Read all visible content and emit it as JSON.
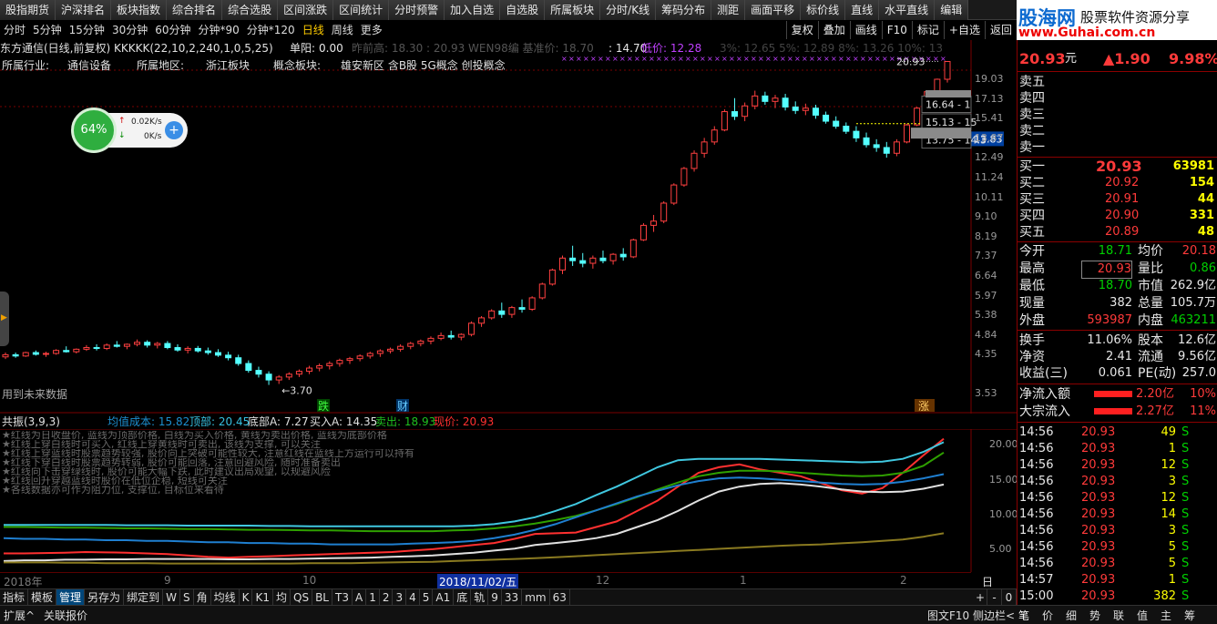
{
  "toolbar": {
    "buttons": [
      "股指期货",
      "沪深排名",
      "板块指数",
      "综合排名",
      "综合选股",
      "区间涨跌",
      "区间统计",
      "分时预警",
      "加入自选",
      "自选股",
      "所属板块",
      "分时/K线",
      "筹码分布",
      "测距",
      "画面平移",
      "标价线",
      "直线",
      "水平直线",
      "编辑"
    ]
  },
  "logo": {
    "main": "股海网",
    "tag": "股票软件资源分享",
    "url": "www.Guhai.com.cn"
  },
  "period_bar": {
    "periods": [
      "分时",
      "5分钟",
      "15分钟",
      "30分钟",
      "60分钟",
      "分钟*90",
      "分钟*120",
      "日线",
      "周线",
      "更多"
    ],
    "active": "日线",
    "right_buttons": [
      "复权",
      "叠加",
      "画线",
      "F10",
      "标记",
      "+自选",
      "返回"
    ]
  },
  "info": {
    "stock": "东方通信(日线,前复权) KKKKK(22,10,2,240,1,0,5,25)",
    "dange_label": "单阳:",
    "dange_value": "0.00",
    "faded": "昨前高: 18.30   : 20.93  WEN98编  基准价: 18.70",
    "mid_value": ": 14.70",
    "low_label": "低价: 12.28",
    "pct": "3%: 12.65  5%: 12.89  8%: 13.26  10%: 13",
    "industry_label": "所属行业:",
    "industry": "通信设备",
    "region_label": "所属地区:",
    "region": "浙江板块",
    "concept_label": "概念板块:",
    "concept": "雄安新区 含B股 5G概念 创投概念"
  },
  "widget": {
    "percent": "64%",
    "up_speed": "0.02K/s",
    "down_speed": "0K/s"
  },
  "price_axis": [
    "19.03",
    "17.13",
    "15.41",
    "13.87",
    "12.49",
    "11.24",
    "10.11",
    "9.10",
    "8.19",
    "7.37",
    "6.64",
    "5.97",
    "5.38",
    "4.84",
    "4.35",
    "3.53"
  ],
  "price_axis_ticks": [
    19.03,
    17.13,
    15.41,
    13.87,
    12.49,
    11.24,
    10.11,
    9.1,
    8.19,
    7.37,
    6.64,
    5.97,
    5.38,
    4.84,
    4.35,
    3.53
  ],
  "axis_top_label": "20.93",
  "current_price_tag": "13.83",
  "range_boxes": [
    "16.64 - 1",
    "15.13 - 15",
    "13.75 - 14.3"
  ],
  "low_marker": "3.70",
  "chart_notes": {
    "future": "用到未来数据",
    "die": "跌",
    "cai": "财",
    "zhang": "涨"
  },
  "indicator": {
    "name": "共振(3,9,3)",
    "avg_cost": "均值成本: 15.82",
    "top": "顶部: 20.45",
    "bottom": "底部A: 7.27",
    "buy": "买入A: 14.35",
    "sell": "卖出: 18.93",
    "current": "现价: 20.93",
    "axis": [
      "20.00",
      "15.00",
      "10.00",
      "5.00"
    ],
    "axis_ticks": [
      20,
      15,
      10,
      5
    ],
    "notes": [
      "红线为日收盘价, 蓝线为顶部价格, 白线为买入价格, 黄线为卖出价格, 蓝线为底部价格",
      "红线上穿白线时可买入, 红线上穿黄线时可卖出, 该线为支撑, 可以关注",
      "红线上穿蓝线时股票趋势较强, 股价向上突破可能性较大, 注意红线在蓝线上方运行可以持有",
      "红线下穿白线时股票趋势转弱, 股价可能回落, 注意回避风险, 随时准备卖出",
      "红线向下击穿绿线时, 股价可能大幅下跌, 此时建议出局观望, 以规避风险",
      "红线回升穿越蓝线时股价在低位企稳, 短线可关注",
      "各线数据亦可作为阻力位, 支撑位, 目标位来看待"
    ]
  },
  "date_axis": {
    "labels": [
      "2018年",
      "9",
      "10",
      "2018/11/02/五",
      "12",
      "1",
      "2"
    ],
    "right": "日线"
  },
  "bottom_bar": [
    "指标",
    "模板",
    "管理",
    "另存为",
    "绑定到",
    "W",
    "S",
    "角",
    "均线",
    "K",
    "K1",
    "均",
    "QS",
    "BL",
    "T3",
    "A",
    "1",
    "2",
    "3",
    "4",
    "5",
    "A1",
    "底",
    "轨",
    "9",
    "33",
    "mm",
    "63"
  ],
  "bottom_active": "管理",
  "bottom_right": [
    "+",
    "-",
    "0"
  ],
  "status": {
    "left": [
      "扩展^",
      "关联报价"
    ],
    "right": [
      "图文F10",
      "侧边栏<",
      "笔",
      "价",
      "细",
      "势",
      "联",
      "值",
      "主",
      "筹"
    ]
  },
  "quote": {
    "price": "20.93",
    "unit": "元",
    "change": "▲1.90",
    "change_pct": "9.98%",
    "sell_levels": [
      "卖五",
      "卖四",
      "卖三",
      "卖二",
      "卖一"
    ],
    "buy_levels": [
      {
        "label": "买一",
        "price": "20.93",
        "vol": "63981"
      },
      {
        "label": "买二",
        "price": "20.92",
        "vol": "154"
      },
      {
        "label": "买三",
        "price": "20.91",
        "vol": "44"
      },
      {
        "label": "买四",
        "price": "20.90",
        "vol": "331"
      },
      {
        "label": "买五",
        "price": "20.89",
        "vol": "48"
      }
    ],
    "stats": [
      {
        "l1": "今开",
        "v1": "18.71",
        "l2": "均价",
        "v2": "20.18"
      },
      {
        "l1": "最高",
        "v1": "20.93",
        "l2": "量比",
        "v2": "0.86"
      },
      {
        "l1": "最低",
        "v1": "18.70",
        "l2": "市值",
        "v2": "262.9亿"
      },
      {
        "l1": "现量",
        "v1": "382",
        "l2": "总量",
        "v2": "105.7万"
      },
      {
        "l1": "外盘",
        "v1": "593987",
        "l2": "内盘",
        "v2": "463211"
      }
    ],
    "fund": [
      {
        "l1": "换手",
        "v1": "11.06%",
        "l2": "股本",
        "v2": "12.6亿"
      },
      {
        "l1": "净资",
        "v1": "2.41",
        "l2": "流通",
        "v2": "9.56亿"
      },
      {
        "l1": "收益(三)",
        "v1": "0.061",
        "l2": "PE(动)",
        "v2": "257.0"
      }
    ],
    "flows": [
      {
        "label": "净流入额",
        "value": "2.20亿",
        "pct": "10%"
      },
      {
        "label": "大宗流入",
        "value": "2.27亿",
        "pct": "11%"
      }
    ],
    "ticks": [
      {
        "t": "14:56",
        "p": "20.93",
        "v": "49",
        "s": "S"
      },
      {
        "t": "14:56",
        "p": "20.93",
        "v": "1",
        "s": "S"
      },
      {
        "t": "14:56",
        "p": "20.93",
        "v": "12",
        "s": "S"
      },
      {
        "t": "14:56",
        "p": "20.93",
        "v": "3",
        "s": "S"
      },
      {
        "t": "14:56",
        "p": "20.93",
        "v": "12",
        "s": "S"
      },
      {
        "t": "14:56",
        "p": "20.93",
        "v": "14",
        "s": "S"
      },
      {
        "t": "14:56",
        "p": "20.93",
        "v": "3",
        "s": "S"
      },
      {
        "t": "14:56",
        "p": "20.93",
        "v": "5",
        "s": "S"
      },
      {
        "t": "14:56",
        "p": "20.93",
        "v": "5",
        "s": "S"
      },
      {
        "t": "14:57",
        "p": "20.93",
        "v": "1",
        "s": "S"
      },
      {
        "t": "15:00",
        "p": "20.93",
        "v": "382",
        "s": "S"
      }
    ]
  },
  "chart_data": {
    "type": "candlestick",
    "ohlc": [
      [
        4.3,
        4.4,
        4.25,
        4.35
      ],
      [
        4.35,
        4.4,
        4.28,
        4.32
      ],
      [
        4.32,
        4.42,
        4.3,
        4.4
      ],
      [
        4.4,
        4.45,
        4.33,
        4.36
      ],
      [
        4.36,
        4.42,
        4.3,
        4.38
      ],
      [
        4.38,
        4.48,
        4.35,
        4.45
      ],
      [
        4.45,
        4.55,
        4.4,
        4.42
      ],
      [
        4.42,
        4.5,
        4.38,
        4.48
      ],
      [
        4.48,
        4.58,
        4.44,
        4.52
      ],
      [
        4.52,
        4.6,
        4.45,
        4.5
      ],
      [
        4.5,
        4.62,
        4.46,
        4.58
      ],
      [
        4.58,
        4.68,
        4.52,
        4.55
      ],
      [
        4.55,
        4.62,
        4.48,
        4.6
      ],
      [
        4.6,
        4.72,
        4.55,
        4.65
      ],
      [
        4.65,
        4.7,
        4.52,
        4.58
      ],
      [
        4.58,
        4.66,
        4.5,
        4.62
      ],
      [
        4.62,
        4.68,
        4.48,
        4.52
      ],
      [
        4.52,
        4.6,
        4.42,
        4.46
      ],
      [
        4.46,
        4.55,
        4.38,
        4.5
      ],
      [
        4.5,
        4.56,
        4.4,
        4.44
      ],
      [
        4.44,
        4.52,
        4.35,
        4.4
      ],
      [
        4.4,
        4.48,
        4.3,
        4.34
      ],
      [
        4.34,
        4.42,
        4.22,
        4.28
      ],
      [
        4.28,
        4.35,
        4.1,
        4.15
      ],
      [
        4.15,
        4.22,
        3.95,
        4.0
      ],
      [
        4.0,
        4.08,
        3.85,
        3.92
      ],
      [
        3.92,
        3.98,
        3.7,
        3.8
      ],
      [
        3.8,
        3.9,
        3.72,
        3.86
      ],
      [
        3.86,
        3.96,
        3.8,
        3.92
      ],
      [
        3.92,
        4.02,
        3.86,
        3.98
      ],
      [
        3.98,
        4.1,
        3.92,
        4.05
      ],
      [
        4.05,
        4.15,
        3.98,
        4.1
      ],
      [
        4.1,
        4.2,
        4.02,
        4.15
      ],
      [
        4.15,
        4.26,
        4.08,
        4.22
      ],
      [
        4.22,
        4.3,
        4.14,
        4.26
      ],
      [
        4.26,
        4.36,
        4.2,
        4.32
      ],
      [
        4.32,
        4.42,
        4.26,
        4.38
      ],
      [
        4.38,
        4.48,
        4.3,
        4.44
      ],
      [
        4.44,
        4.52,
        4.38,
        4.48
      ],
      [
        4.48,
        4.6,
        4.42,
        4.55
      ],
      [
        4.55,
        4.66,
        4.48,
        4.62
      ],
      [
        4.62,
        4.72,
        4.55,
        4.68
      ],
      [
        4.68,
        4.8,
        4.6,
        4.75
      ],
      [
        4.75,
        4.9,
        4.7,
        4.82
      ],
      [
        4.82,
        4.95,
        4.72,
        4.78
      ],
      [
        4.78,
        4.88,
        4.7,
        4.85
      ],
      [
        4.85,
        5.2,
        4.8,
        5.15
      ],
      [
        5.15,
        5.35,
        5.05,
        5.3
      ],
      [
        5.3,
        5.55,
        5.25,
        5.5
      ],
      [
        5.5,
        5.75,
        5.3,
        5.4
      ],
      [
        5.4,
        5.65,
        5.3,
        5.6
      ],
      [
        5.6,
        5.85,
        5.45,
        5.55
      ],
      [
        5.55,
        5.95,
        5.5,
        5.9
      ],
      [
        5.9,
        6.4,
        5.85,
        6.35
      ],
      [
        6.35,
        6.9,
        6.3,
        6.85
      ],
      [
        6.85,
        7.4,
        6.7,
        7.3
      ],
      [
        7.3,
        7.8,
        7.0,
        7.2
      ],
      [
        7.2,
        7.5,
        6.95,
        7.1
      ],
      [
        7.1,
        7.4,
        6.9,
        7.3
      ],
      [
        7.3,
        7.6,
        7.1,
        7.2
      ],
      [
        7.2,
        7.5,
        7.05,
        7.45
      ],
      [
        7.45,
        7.7,
        7.2,
        7.35
      ],
      [
        7.35,
        8.1,
        7.3,
        8.05
      ],
      [
        8.05,
        8.8,
        8.0,
        8.7
      ],
      [
        8.7,
        9.2,
        8.4,
        8.9
      ],
      [
        8.9,
        9.9,
        8.8,
        9.8
      ],
      [
        9.8,
        10.9,
        9.7,
        10.8
      ],
      [
        10.8,
        11.9,
        10.7,
        11.8
      ],
      [
        11.8,
        13.0,
        11.6,
        12.8
      ],
      [
        12.8,
        13.9,
        12.5,
        13.6
      ],
      [
        13.6,
        14.8,
        13.4,
        14.5
      ],
      [
        14.5,
        16.2,
        14.4,
        16.0
      ],
      [
        16.0,
        17.2,
        15.3,
        15.6
      ],
      [
        15.6,
        16.8,
        15.2,
        16.5
      ],
      [
        16.5,
        17.9,
        16.2,
        17.4
      ],
      [
        17.4,
        17.8,
        16.6,
        16.9
      ],
      [
        16.9,
        17.5,
        16.3,
        17.2
      ],
      [
        17.2,
        17.6,
        16.1,
        16.4
      ],
      [
        16.4,
        16.9,
        15.8,
        16.1
      ],
      [
        16.1,
        16.7,
        15.7,
        16.3
      ],
      [
        16.3,
        16.6,
        15.4,
        15.7
      ],
      [
        15.7,
        16.0,
        15.0,
        15.2
      ],
      [
        15.2,
        15.6,
        14.6,
        14.8
      ],
      [
        14.8,
        15.1,
        14.2,
        14.4
      ],
      [
        14.4,
        14.8,
        13.6,
        13.9
      ],
      [
        13.9,
        14.3,
        13.2,
        13.4
      ],
      [
        13.4,
        13.8,
        12.9,
        13.2
      ],
      [
        13.2,
        13.6,
        12.5,
        12.8
      ],
      [
        12.8,
        13.8,
        12.6,
        13.6
      ],
      [
        13.6,
        15.0,
        13.5,
        14.9
      ],
      [
        14.9,
        16.4,
        14.8,
        16.3
      ],
      [
        16.3,
        17.9,
        16.2,
        17.8
      ],
      [
        17.8,
        19.1,
        17.5,
        19.03
      ],
      [
        19.03,
        20.93,
        18.7,
        20.93
      ]
    ],
    "indicator_lines": {
      "red": [
        4.4,
        4.4,
        4.45,
        4.5,
        4.6,
        4.55,
        4.5,
        4.4,
        4.3,
        4.1,
        3.9,
        3.8,
        3.9,
        4.0,
        4.1,
        4.2,
        4.3,
        4.4,
        4.5,
        4.6,
        4.8,
        5.0,
        5.3,
        5.6,
        5.9,
        6.5,
        7.2,
        7.3,
        7.4,
        8.2,
        9.0,
        10.5,
        12.0,
        14.0,
        16.0,
        16.8,
        17.2,
        16.5,
        16.0,
        15.5,
        14.5,
        13.5,
        13.0,
        13.8,
        16.0,
        18.5,
        20.9
      ],
      "white": [
        3.3,
        3.4,
        3.4,
        3.5,
        3.5,
        3.55,
        3.55,
        3.6,
        3.6,
        3.6,
        3.6,
        3.55,
        3.55,
        3.6,
        3.6,
        3.65,
        3.7,
        3.75,
        3.8,
        3.9,
        4.0,
        4.1,
        4.3,
        4.5,
        4.8,
        5.1,
        5.6,
        5.9,
        6.2,
        6.6,
        7.2,
        8.2,
        9.2,
        10.5,
        12.0,
        13.3,
        14.0,
        14.4,
        14.5,
        14.3,
        14.0,
        13.6,
        13.3,
        13.2,
        13.3,
        13.7,
        14.3
      ],
      "yellow": [
        8.2,
        8.2,
        8.15,
        8.1,
        8.1,
        8.05,
        8.0,
        8.0,
        7.95,
        7.9,
        7.9,
        7.85,
        7.8,
        7.8,
        7.75,
        7.7,
        7.7,
        7.65,
        7.6,
        7.6,
        7.6,
        7.6,
        7.7,
        7.8,
        8.0,
        8.3,
        8.7,
        9.2,
        9.8,
        10.6,
        11.5,
        12.5,
        13.6,
        14.6,
        15.5,
        16.0,
        16.3,
        16.3,
        16.2,
        16.0,
        15.8,
        15.6,
        15.5,
        15.6,
        16.0,
        17.0,
        18.9
      ],
      "cyan": [
        8.5,
        8.5,
        8.5,
        8.5,
        8.5,
        8.5,
        8.45,
        8.45,
        8.45,
        8.4,
        8.4,
        8.4,
        8.4,
        8.35,
        8.35,
        8.3,
        8.3,
        8.3,
        8.3,
        8.3,
        8.3,
        8.3,
        8.3,
        8.4,
        8.6,
        9.0,
        9.6,
        10.5,
        11.5,
        12.8,
        14.0,
        15.4,
        16.8,
        17.8,
        18.0,
        18.0,
        18.0,
        18.0,
        17.9,
        17.8,
        17.7,
        17.6,
        17.5,
        17.6,
        18.0,
        19.0,
        20.4
      ],
      "blue": [
        6.6,
        6.5,
        6.5,
        6.4,
        6.4,
        6.3,
        6.3,
        6.2,
        6.2,
        6.1,
        6.0,
        6.0,
        5.9,
        5.9,
        5.8,
        5.8,
        5.7,
        5.7,
        5.7,
        5.7,
        5.8,
        5.9,
        6.0,
        6.2,
        6.6,
        7.1,
        7.8,
        8.6,
        9.6,
        10.6,
        11.6,
        12.6,
        13.4,
        14.2,
        14.8,
        15.2,
        15.3,
        15.2,
        15.0,
        14.8,
        14.6,
        14.4,
        14.3,
        14.4,
        14.7,
        15.2,
        15.8
      ],
      "olive": [
        3.1,
        3.1,
        3.1,
        3.05,
        3.05,
        3.0,
        3.0,
        3.0,
        2.95,
        2.95,
        2.95,
        2.95,
        2.95,
        2.95,
        2.95,
        3.0,
        3.0,
        3.0,
        3.05,
        3.1,
        3.15,
        3.2,
        3.3,
        3.4,
        3.5,
        3.6,
        3.7,
        3.85,
        4.0,
        4.15,
        4.3,
        4.45,
        4.6,
        4.75,
        4.9,
        5.05,
        5.2,
        5.35,
        5.5,
        5.6,
        5.7,
        5.85,
        6.0,
        6.2,
        6.4,
        6.8,
        7.3
      ]
    },
    "price_range": [
      3.3,
      21.5
    ],
    "indicator_range": [
      2.5,
      21.5
    ]
  }
}
